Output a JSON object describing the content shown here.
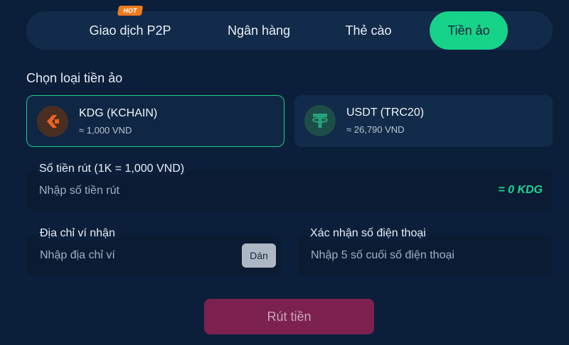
{
  "tabs": [
    {
      "label": "Giao dịch P2P",
      "active": false
    },
    {
      "label": "Ngân hàng",
      "active": false
    },
    {
      "label": "Thẻ cào",
      "active": false
    },
    {
      "label": "Tiền ảo",
      "active": true
    }
  ],
  "hot_badge": "HOT",
  "section_title": "Chọn loại tiền ảo",
  "coins": [
    {
      "name": "KDG (KCHAIN)",
      "rate": "≈ 1,000 VND",
      "icon": "kdg-logo-icon",
      "selected": true
    },
    {
      "name": "USDT (TRC20)",
      "rate": "≈ 26,790 VND",
      "icon": "tether-logo-icon",
      "selected": false
    }
  ],
  "amount": {
    "label": "Số tiền rút (1K = 1,000 VND)",
    "placeholder": "Nhập số tiền rút",
    "value": "",
    "suffix": "= 0 KDG"
  },
  "wallet": {
    "label": "Địa chỉ ví nhận",
    "placeholder": "Nhập địa chỉ ví",
    "value": "",
    "paste_label": "Dán"
  },
  "phone": {
    "label": "Xác nhận số điện thoại",
    "placeholder": "Nhập 5 số cuối số điện thoại",
    "value": ""
  },
  "submit_label": "Rút tiền",
  "colors": {
    "background": "#0c1f3a",
    "accent": "#17d38a",
    "submit": "#7d2150",
    "hot": "#f07a1d"
  }
}
